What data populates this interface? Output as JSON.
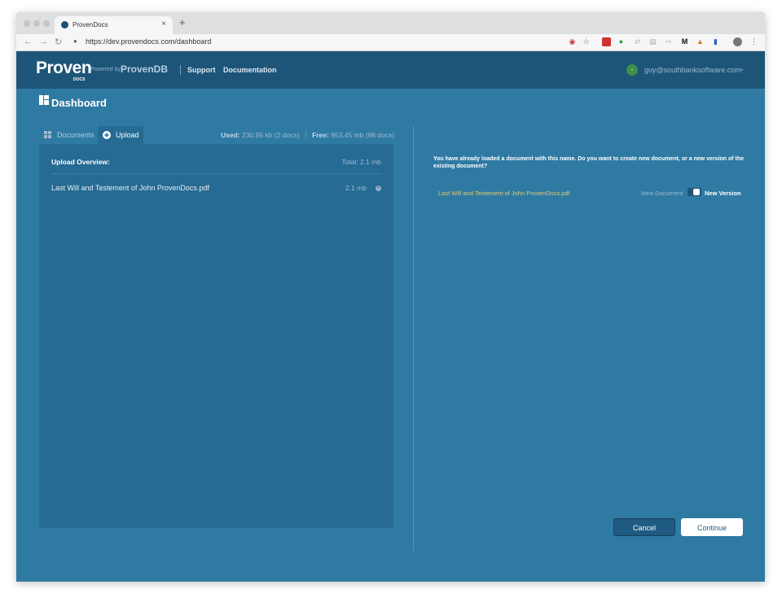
{
  "browser": {
    "tab_title": "ProvenDocs",
    "tab_close": "×",
    "new_tab": "+",
    "url": "https://dev.provendocs.com/dashboard",
    "back": "←",
    "forward": "→",
    "reload": "↻",
    "lock": "🔒",
    "menu": "⋮",
    "bookmark_star": "☆"
  },
  "header": {
    "logo": "Proven",
    "logo_sub": "DOCS",
    "powered_by": "Powered by",
    "provendb": "ProvenDB",
    "nav": [
      "Support",
      "Documentation"
    ],
    "user_email": "guy@southbanksoftware.com",
    "user_chevron": "⌄"
  },
  "page": {
    "title": "Dashboard"
  },
  "left": {
    "tabs": [
      {
        "label": "Documents",
        "icon": "grid-icon",
        "active": false
      },
      {
        "label": "Upload",
        "icon": "plus-circle-icon",
        "active": true
      }
    ],
    "used_label": "Used:",
    "used_value": "230.95 kb (2 docs)",
    "free_label": "Free:",
    "free_value": "953.45 mb (98 docs)",
    "overview_title": "Upload Overview:",
    "overview_total": "Total: 2.1 mb",
    "files": [
      {
        "name": "Last Will and Testement of John ProvenDocs.pdf",
        "size": "2.1 mb"
      }
    ]
  },
  "right": {
    "question": "You have already loaded a document with this name. Do you want to create new document, or a new version of the existing document?",
    "file_name": "Last Will and Testement of John ProvenDocs.pdf",
    "option_new_document": "New Document",
    "option_new_version": "New Version",
    "toggle_selected": "New Version",
    "cancel_label": "Cancel",
    "continue_label": "Continue"
  },
  "colors": {
    "header_bg": "#1d5578",
    "page_bg": "#2f7aa3",
    "panel_bg": "#256b93",
    "filename_highlight": "#e5c86d"
  }
}
